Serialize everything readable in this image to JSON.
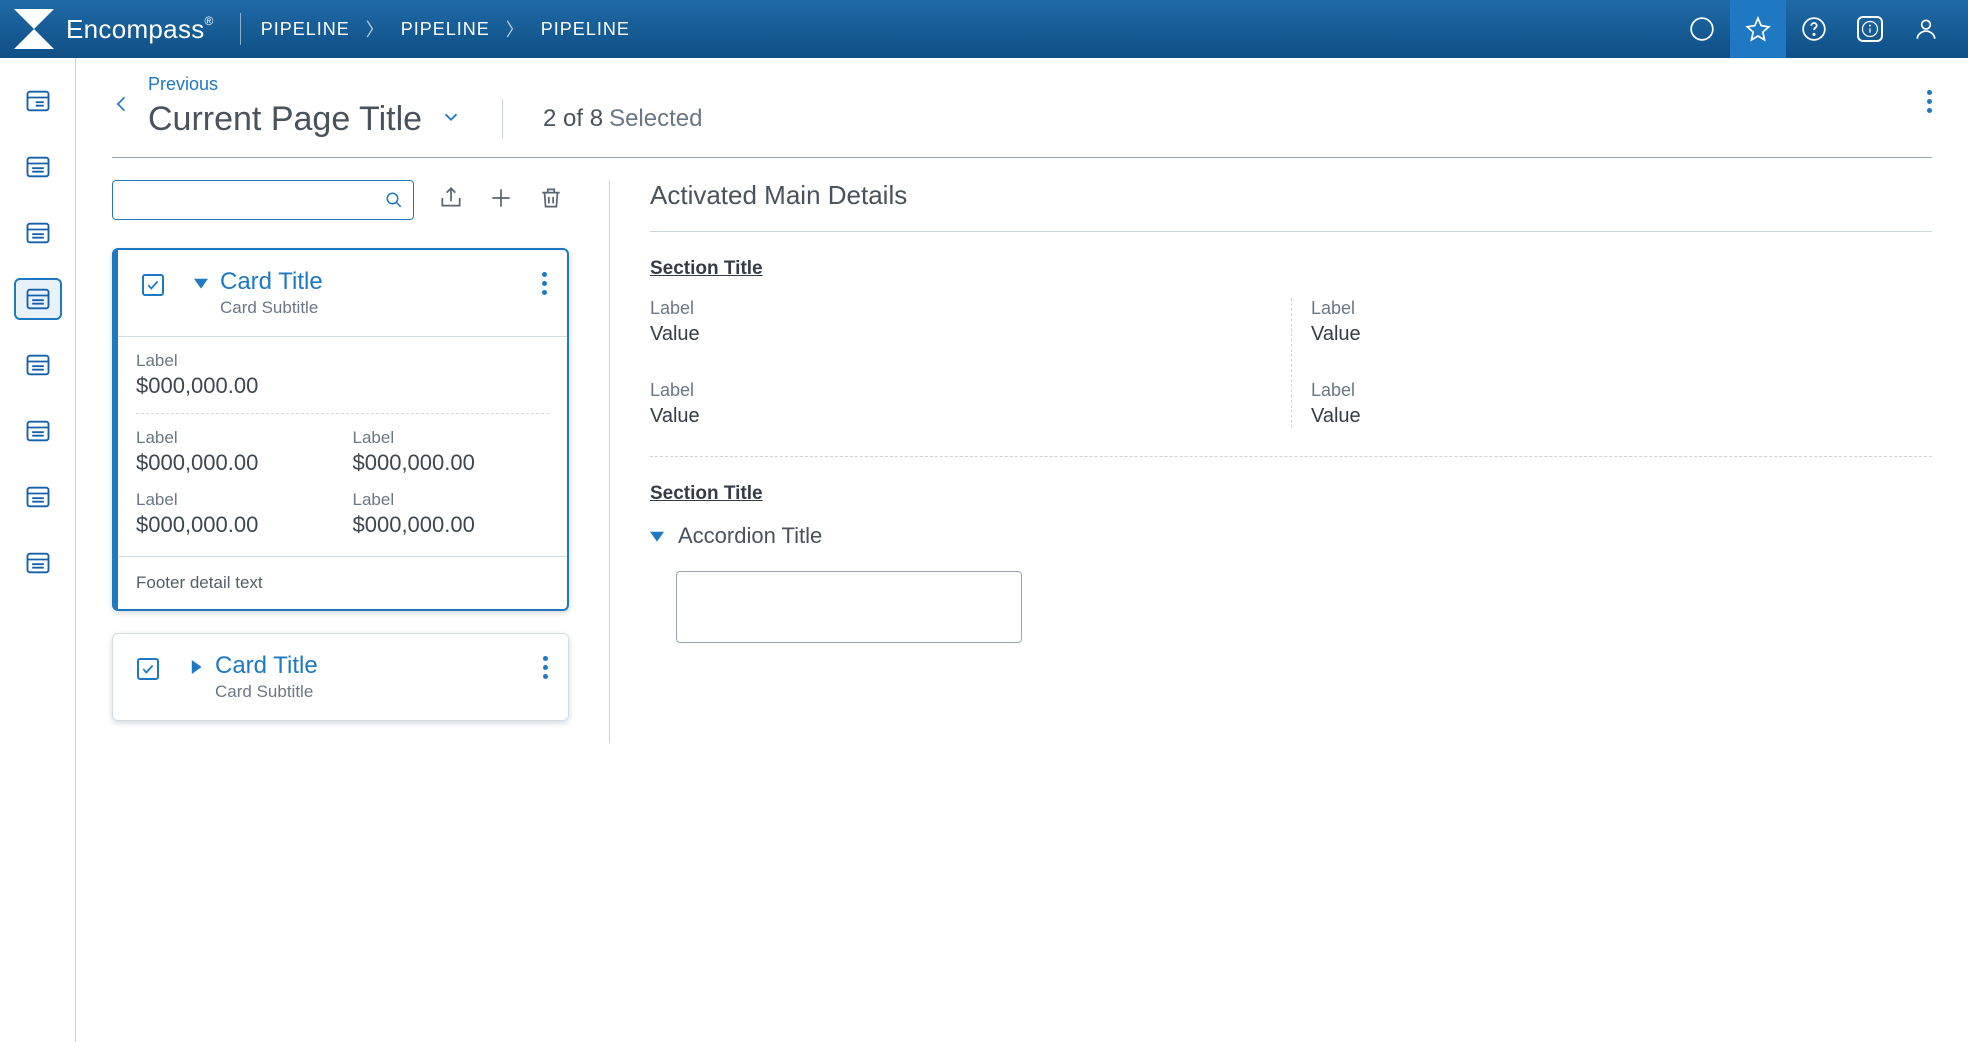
{
  "app": {
    "name": "Encompass"
  },
  "breadcrumbs": [
    "PIPELINE",
    "PIPELINE",
    "PIPELINE"
  ],
  "page": {
    "previous_label": "Previous",
    "title": "Current Page Title",
    "count_text": "2 of 8",
    "selected_label": "Selected"
  },
  "search": {
    "placeholder": ""
  },
  "cards": [
    {
      "title": "Card Title",
      "subtitle": "Card Subtitle",
      "primary": {
        "label": "Label",
        "value": "$000,000.00"
      },
      "grid": [
        {
          "label": "Label",
          "value": "$000,000.00"
        },
        {
          "label": "Label",
          "value": "$000,000.00"
        },
        {
          "label": "Label",
          "value": "$000,000.00"
        },
        {
          "label": "Label",
          "value": "$000,000.00"
        }
      ],
      "footer": "Footer detail text"
    },
    {
      "title": "Card Title",
      "subtitle": "Card Subtitle"
    }
  ],
  "details": {
    "title": "Activated Main Details",
    "sections": [
      {
        "title": "Section Title",
        "pairs": [
          {
            "label": "Label",
            "value": "Value"
          },
          {
            "label": "Label",
            "value": "Value"
          },
          {
            "label": "Label",
            "value": "Value"
          },
          {
            "label": "Label",
            "value": "Value"
          }
        ]
      },
      {
        "title": "Section Title",
        "accordion": "Accordion Title"
      }
    ]
  }
}
